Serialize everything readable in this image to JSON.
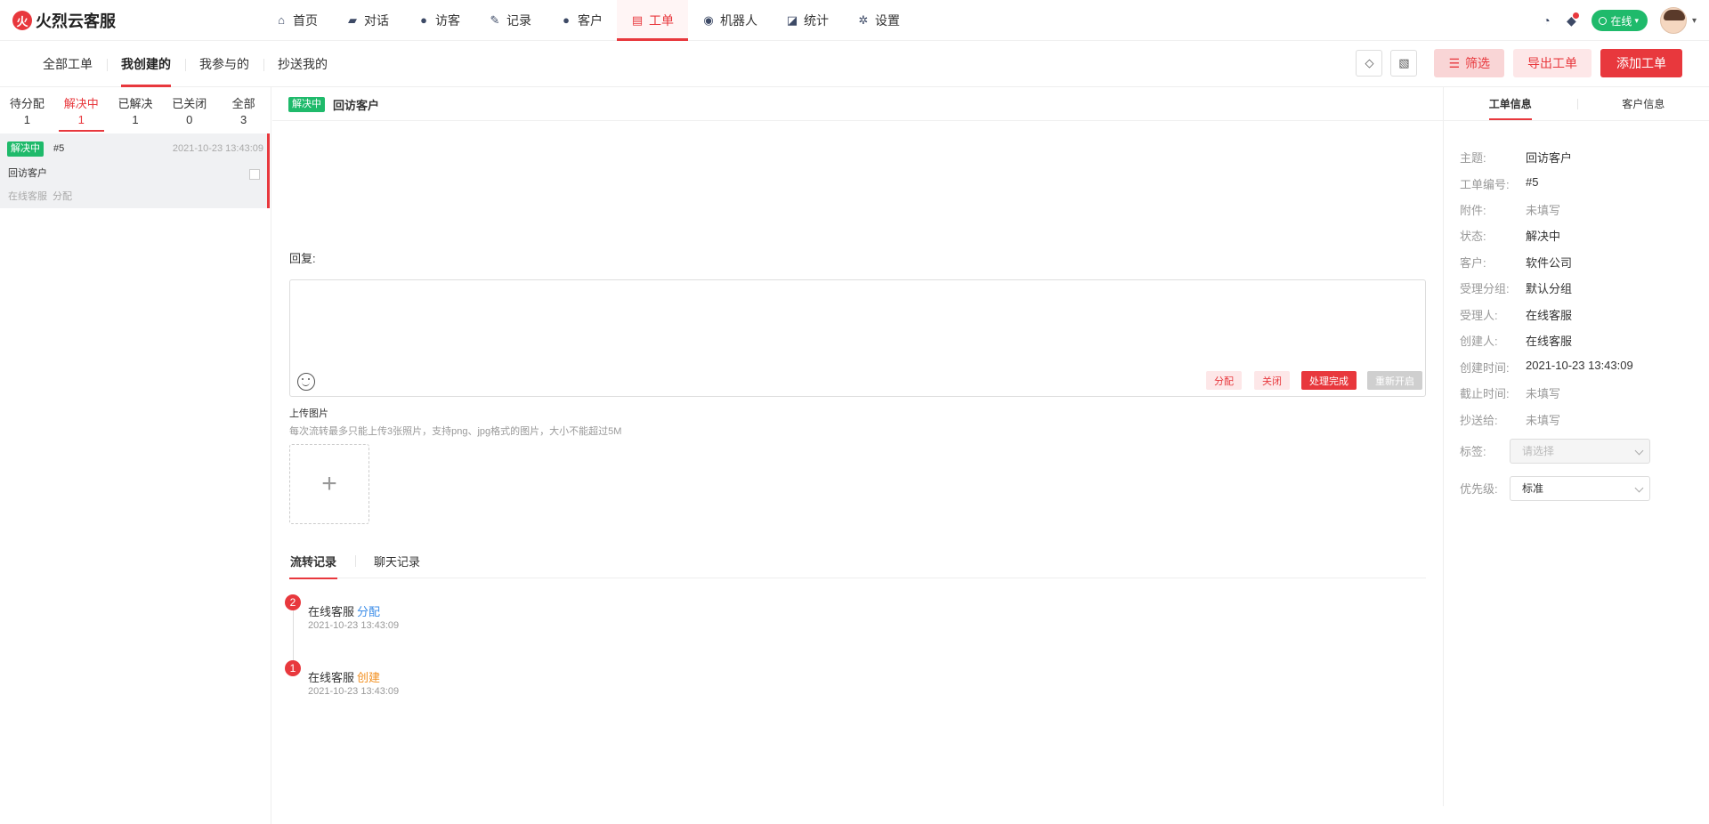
{
  "brand": {
    "name": "火烈云客服",
    "logo_glyph": "火"
  },
  "nav": [
    {
      "label": "首页",
      "icon": "home-icon",
      "glyph": "⌂",
      "active": false
    },
    {
      "label": "对话",
      "icon": "chat-icon",
      "glyph": "▰",
      "active": false
    },
    {
      "label": "访客",
      "icon": "visitors-icon",
      "glyph": "●",
      "active": false
    },
    {
      "label": "记录",
      "icon": "records-icon",
      "glyph": "✎",
      "active": false
    },
    {
      "label": "客户",
      "icon": "customer-icon",
      "glyph": "●",
      "active": false
    },
    {
      "label": "工单",
      "icon": "ticket-icon",
      "glyph": "▤",
      "active": true
    },
    {
      "label": "机器人",
      "icon": "robot-icon",
      "glyph": "◉",
      "active": false
    },
    {
      "label": "统计",
      "icon": "stats-icon",
      "glyph": "◪",
      "active": false
    },
    {
      "label": "设置",
      "icon": "settings-icon",
      "glyph": "✲",
      "active": false
    }
  ],
  "topright": {
    "status": "在线",
    "headset_glyph": "◔",
    "bell_glyph": "◆",
    "status_caret": "▾",
    "caret": "▾"
  },
  "subtabs": [
    "全部工单",
    "我创建的",
    "我参与的",
    "抄送我的"
  ],
  "subtab_active": 1,
  "actions": {
    "tag_glyph": "◇",
    "chart_glyph": "▧",
    "filter_glyph": "☰",
    "filter": "筛选",
    "export": "导出工单",
    "add": "添加工单"
  },
  "status_tabs": [
    {
      "label": "待分配",
      "count": "1"
    },
    {
      "label": "解决中",
      "count": "1"
    },
    {
      "label": "已解决",
      "count": "1"
    },
    {
      "label": "已关闭",
      "count": "0"
    },
    {
      "label": "全部",
      "count": "3"
    }
  ],
  "status_active": 1,
  "ticket_list": [
    {
      "status": "解决中",
      "no": "#5",
      "time": "2021-10-23 13:43:09",
      "title": "回访客户",
      "agent": "在线客服",
      "action": "分配"
    }
  ],
  "detail": {
    "status": "解决中",
    "title": "回访客户",
    "reply_label": "回复:",
    "reply_value": "",
    "buttons": {
      "assign": "分配",
      "close": "关闭",
      "done": "处理完成",
      "reopen": "重新开启"
    },
    "upload_title": "上传图片",
    "upload_hint": "每次流转最多只能上传3张照片，支持png、jpg格式的图片，大小不能超过5M",
    "upload_plus": "+",
    "record_tabs": [
      "流转记录",
      "聊天记录"
    ],
    "record_active": 0,
    "timeline": [
      {
        "num": "2",
        "agent": "在线客服",
        "action": "分配",
        "action_color": "blue",
        "time": "2021-10-23 13:43:09"
      },
      {
        "num": "1",
        "agent": "在线客服",
        "action": "创建",
        "action_color": "orange",
        "time": "2021-10-23 13:43:09"
      }
    ]
  },
  "right": {
    "tabs": [
      "工单信息",
      "客户信息"
    ],
    "tab_active": 0,
    "fields": [
      {
        "label": "主题:",
        "value": "回访客户",
        "muted": false
      },
      {
        "label": "工单编号:",
        "value": "#5",
        "muted": false
      },
      {
        "label": "附件:",
        "value": "未填写",
        "muted": true
      },
      {
        "label": "状态:",
        "value": "解决中",
        "muted": false
      },
      {
        "label": "客户:",
        "value": "软件公司",
        "muted": false
      },
      {
        "label": "受理分组:",
        "value": "默认分组",
        "muted": false
      },
      {
        "label": "受理人:",
        "value": "在线客服",
        "muted": false
      },
      {
        "label": "创建人:",
        "value": "在线客服",
        "muted": false
      },
      {
        "label": "创建时间:",
        "value": "2021-10-23 13:43:09",
        "muted": false
      },
      {
        "label": "截止时间:",
        "value": "未填写",
        "muted": true
      },
      {
        "label": "抄送给:",
        "value": "未填写",
        "muted": true
      }
    ],
    "tag_label": "标签:",
    "tag_placeholder": "请选择",
    "priority_label": "优先级:",
    "priority_value": "标准"
  }
}
